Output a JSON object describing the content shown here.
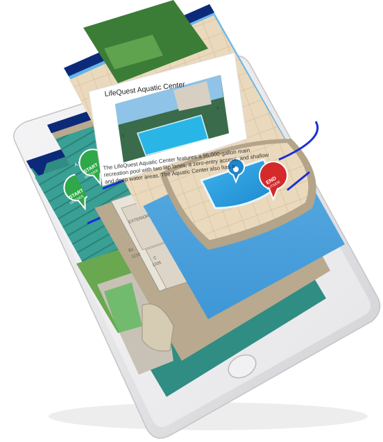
{
  "popup": {
    "title": "LifeQuest Aquatic Center",
    "description": "The LifeQuest Aquatic Center features a 95,000-gallon main recreation pool with two lap lanes, a zero-entry access, and shallow and deep water areas. The Aquatic Center also has a"
  },
  "markers": {
    "start_label": "START",
    "start_sub": "OUTSIDE",
    "end_label": "END",
    "end_sub": "OUTSIDE"
  },
  "map_labels": {
    "exterior": "EXTERIOR AT",
    "room_a1": "A1",
    "room_b1": "B1",
    "room_b1_num": "1210",
    "room_c": "C",
    "room_c_num": "1205",
    "room_2": "1210"
  },
  "colors": {
    "header_blue": "#0d2a7a",
    "teal_building": "#3fa89d",
    "pool_blue": "#2e9ce0",
    "water_blue": "#5ab0e8",
    "route_blue": "#1a2fd6",
    "start_green": "#2fa84a",
    "end_red": "#d42a2a",
    "phone_silver": "#e8e8ea"
  }
}
